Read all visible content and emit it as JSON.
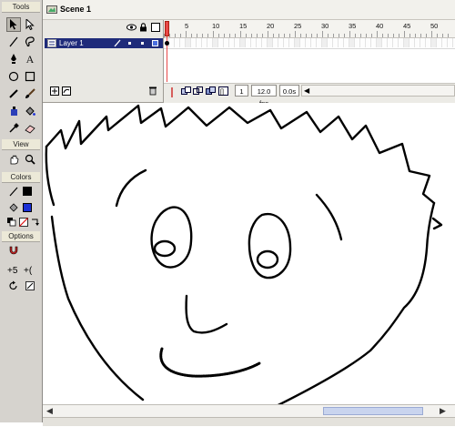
{
  "tools_panel": {
    "title": "Tools",
    "view_title": "View",
    "colors_title": "Colors",
    "options_title": "Options",
    "tool_icons": [
      "arrow-icon",
      "subselect-icon",
      "line-icon",
      "lasso-icon",
      "pen-icon",
      "text-icon",
      "oval-icon",
      "rectangle-icon",
      "pencil-icon",
      "brush-icon",
      "ink-bottle-icon",
      "paint-bucket-icon",
      "eyedropper-icon",
      "eraser-icon",
      "hand-icon",
      "zoom-icon"
    ],
    "colors": {
      "stroke": "#000000",
      "fill": "#1a2fd6"
    }
  },
  "scene": {
    "label": "Scene 1"
  },
  "timeline": {
    "frame_numbers": [
      "5",
      "10",
      "15",
      "20",
      "25",
      "30",
      "35",
      "40",
      "45",
      "50"
    ],
    "layers": [
      {
        "name": "Layer 1"
      }
    ],
    "current_frame": "1",
    "fps": "12.0 fps",
    "time": "0.0s"
  }
}
